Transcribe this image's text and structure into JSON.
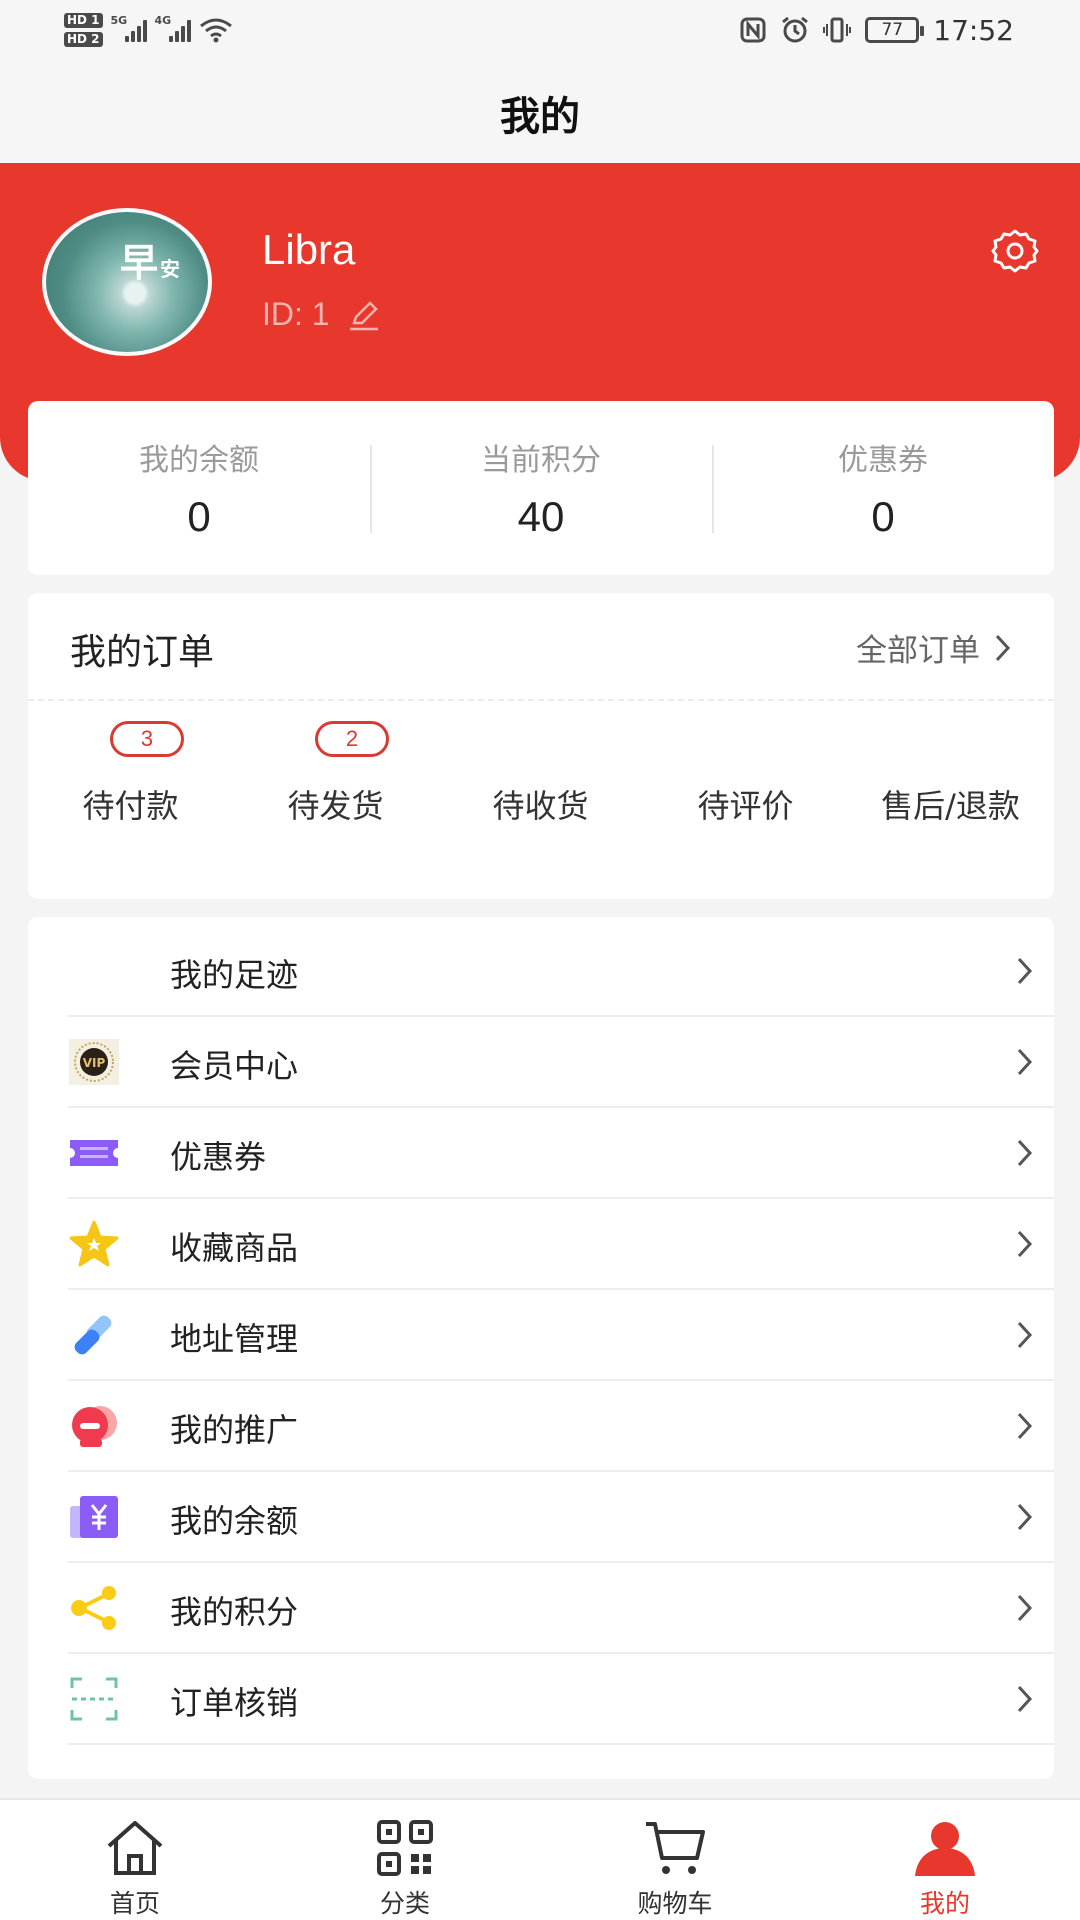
{
  "status_bar": {
    "hd1": "HD 1",
    "hd2": "HD 2",
    "net1": "5G",
    "net2": "4G",
    "battery": "77",
    "time": "17:52"
  },
  "header": {
    "title": "我的"
  },
  "profile": {
    "name": "Libra",
    "id_text": "ID:  1",
    "avatar_text": "早",
    "avatar_small": "安"
  },
  "stats": [
    {
      "label": "我的余额",
      "value": "0"
    },
    {
      "label": "当前积分",
      "value": "40"
    },
    {
      "label": "优惠券",
      "value": "0"
    }
  ],
  "orders": {
    "title": "我的订单",
    "all_label": "全部订单",
    "items": [
      {
        "label": "待付款",
        "badge": "3"
      },
      {
        "label": "待发货",
        "badge": "2"
      },
      {
        "label": "待收货"
      },
      {
        "label": "待评价"
      },
      {
        "label": "售后/退款"
      }
    ]
  },
  "menu": [
    {
      "label": "我的足迹",
      "icon": "footprint"
    },
    {
      "label": "会员中心",
      "icon": "vip-icon"
    },
    {
      "label": "优惠券",
      "icon": "coupon-icon"
    },
    {
      "label": "收藏商品",
      "icon": "star-icon"
    },
    {
      "label": "地址管理",
      "icon": "link-icon"
    },
    {
      "label": "我的推广",
      "icon": "promotion-icon"
    },
    {
      "label": "我的余额",
      "icon": "yuan-icon"
    },
    {
      "label": "我的积分",
      "icon": "share-icon"
    },
    {
      "label": "订单核销",
      "icon": "scan-icon"
    }
  ],
  "tabs": [
    {
      "label": "首页",
      "icon": "home-icon"
    },
    {
      "label": "分类",
      "icon": "qrcode-icon"
    },
    {
      "label": "购物车",
      "icon": "cart-icon"
    },
    {
      "label": "我的",
      "icon": "user-icon",
      "active": true
    }
  ],
  "colors": {
    "brand_red": "#e8372c",
    "badge_red": "#d93a33"
  }
}
